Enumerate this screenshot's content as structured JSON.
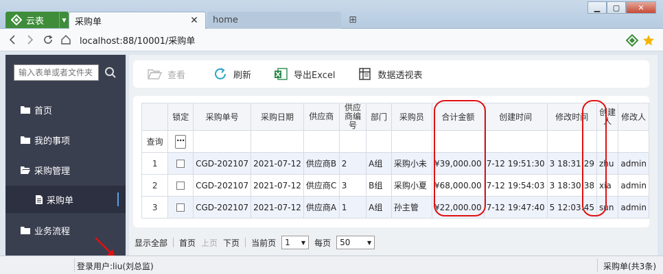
{
  "app": {
    "name": "云表"
  },
  "tabs": [
    {
      "label": "采购单",
      "active": true
    },
    {
      "label": "home",
      "active": false
    }
  ],
  "address": {
    "url": "localhost:88/10001/采购单"
  },
  "sidebar": {
    "search_placeholder": "输入表单或者文件夹",
    "items": [
      {
        "label": "首页",
        "icon": "folder-icon"
      },
      {
        "label": "我的事项",
        "icon": "folder-icon"
      },
      {
        "label": "采购管理",
        "icon": "folder-open-icon"
      },
      {
        "label": "采购单",
        "icon": "document-icon"
      },
      {
        "label": "业务流程",
        "icon": "folder-icon"
      }
    ]
  },
  "toolbar": {
    "view": "查看",
    "refresh": "刷新",
    "export": "导出Excel",
    "pivot": "数据透视表"
  },
  "grid": {
    "headers": [
      "锁定",
      "采购单号",
      "采购日期",
      "供应商",
      "供应商编号",
      "部门",
      "采购员",
      "合计金额",
      "创建时间",
      "修改时间",
      "创建人",
      "修改人"
    ],
    "filter_label": "查询",
    "rows": [
      {
        "n": "1",
        "no": "CGD-202107",
        "date": "2021-07-12",
        "supplier": "供应商B",
        "sup_no": "2",
        "dept": "A组",
        "buyer": "采购小未",
        "amount": "¥39,000.00",
        "created": "7-12 19:51:30",
        "modified": "3 18:31:29",
        "creator": "zhu",
        "modifier": "admin"
      },
      {
        "n": "2",
        "no": "CGD-202107",
        "date": "2021-07-12",
        "supplier": "供应商C",
        "sup_no": "3",
        "dept": "B组",
        "buyer": "采购小夏",
        "amount": "¥68,000.00",
        "created": "7-12 19:54:03",
        "modified": "3 18:30:38",
        "creator": "xia",
        "modifier": "admin"
      },
      {
        "n": "3",
        "no": "CGD-202107",
        "date": "2021-07-12",
        "supplier": "供应商A",
        "sup_no": "1",
        "dept": "A组",
        "buyer": "孙主管",
        "amount": "¥22,000.00",
        "created": "7-12 19:47:40",
        "modified": "5 12:03:45",
        "creator": "sun",
        "modifier": "admin"
      }
    ]
  },
  "pager": {
    "show_all": "显示全部",
    "first": "首页",
    "prev": "上页",
    "next": "下页",
    "current_label": "当前页",
    "current_value": "1",
    "per_page_label": "每页",
    "per_page_value": "50"
  },
  "status": {
    "left": "登录用户:liu(刘总监)",
    "right": "采购单(共3条)"
  },
  "colors": {
    "sidebar_bg": "#3a3f50",
    "app_green": "#3f8d3a",
    "highlight_red": "#e01010"
  }
}
